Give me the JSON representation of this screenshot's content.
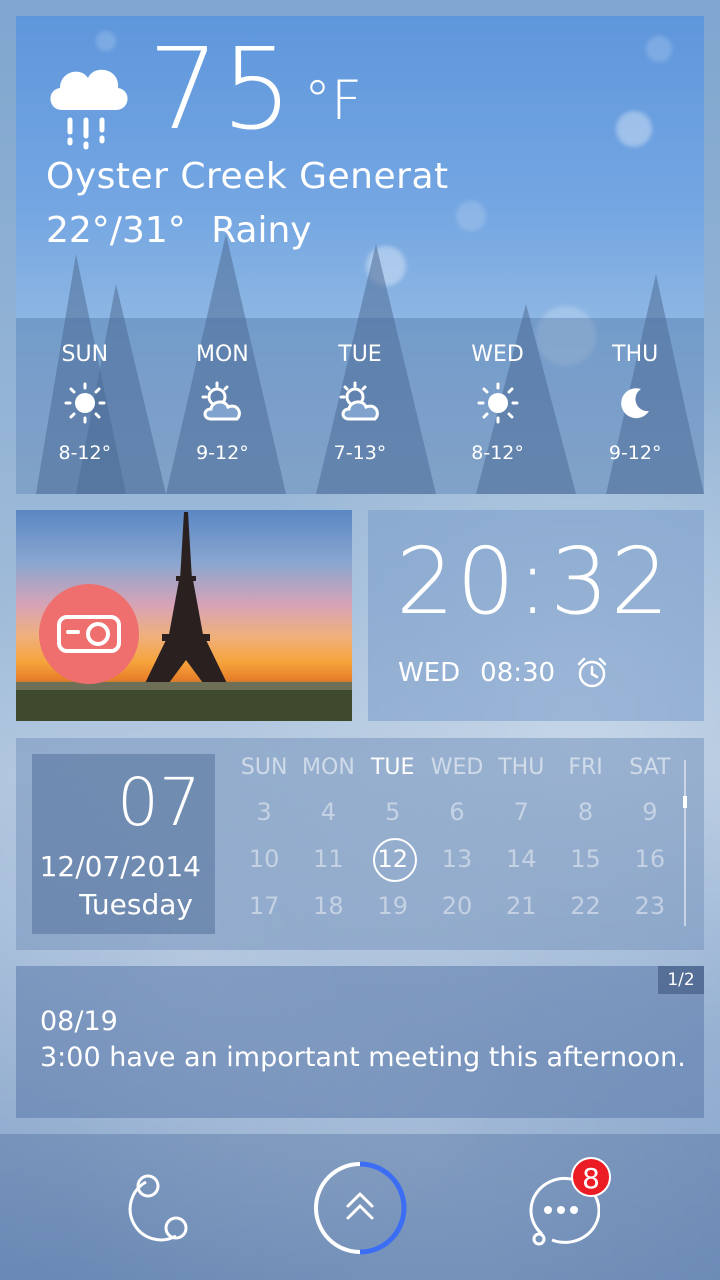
{
  "weather": {
    "current_temp": "75",
    "unit": "°F",
    "location": "Oyster Creek Generat",
    "range": "22°/31°",
    "condition": "Rainy",
    "condition_icon": "rain-cloud-icon",
    "forecast": [
      {
        "day": "SUN",
        "icon": "sun-icon",
        "range": "8-12°"
      },
      {
        "day": "MON",
        "icon": "partly-cloudy-icon",
        "range": "9-12°"
      },
      {
        "day": "TUE",
        "icon": "partly-cloudy-icon",
        "range": "7-13°"
      },
      {
        "day": "WED",
        "icon": "sun-icon",
        "range": "8-12°"
      },
      {
        "day": "THU",
        "icon": "moon-icon",
        "range": "9-12°"
      }
    ]
  },
  "photo": {
    "camera_icon": "camera-icon"
  },
  "clock": {
    "time": "20:32",
    "alarm_day": "WED",
    "alarm_time": "08:30",
    "alarm_icon": "alarm-clock-icon"
  },
  "calendar": {
    "day": "07",
    "full_date": "12/07/2014",
    "weekday": "Tuesday",
    "headers": [
      "SUN",
      "MON",
      "TUE",
      "WED",
      "THU",
      "FRI",
      "SAT"
    ],
    "rows": [
      [
        "3",
        "4",
        "5",
        "6",
        "7",
        "8",
        "9"
      ],
      [
        "10",
        "11",
        "12",
        "13",
        "14",
        "15",
        "16"
      ],
      [
        "17",
        "18",
        "19",
        "20",
        "21",
        "22",
        "23"
      ]
    ]
  },
  "note": {
    "page": "1/2",
    "date": "08/19",
    "text": "3:00 have an important meeting this afternoon."
  },
  "dock": {
    "left_icon": "orbit-icon",
    "center_icon": "double-chevron-up-icon",
    "right_icon": "chat-bubble-icon",
    "badge": "8",
    "accent": "#3b6ef5",
    "badge_color": "#ec1c24"
  }
}
